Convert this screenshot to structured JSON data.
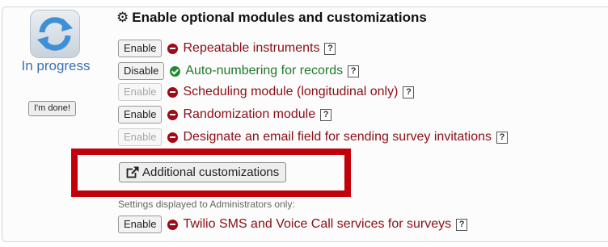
{
  "status": {
    "label": "In progress",
    "done_button": "I'm done!",
    "icon": "sync-arrows-icon"
  },
  "section": {
    "title": "Enable optional modules and customizations",
    "icon": "gears-icon"
  },
  "modules": [
    {
      "button": "Enable",
      "button_enabled": true,
      "status": "red",
      "label": "Repeatable instruments",
      "help": "?"
    },
    {
      "button": "Disable",
      "button_enabled": true,
      "status": "green",
      "label": "Auto-numbering for records",
      "help": "?"
    },
    {
      "button": "Enable",
      "button_enabled": false,
      "status": "red",
      "label": "Scheduling module (longitudinal only)",
      "help": "?"
    },
    {
      "button": "Enable",
      "button_enabled": true,
      "status": "red",
      "label": "Randomization module",
      "help": "?"
    },
    {
      "button": "Enable",
      "button_enabled": false,
      "status": "red",
      "label": "Designate an email field for sending survey invitations",
      "help": "?"
    }
  ],
  "customizations_button": "Additional customizations",
  "admin_note": "Settings displayed to Administrators only:",
  "admin_modules": [
    {
      "button": "Enable",
      "button_enabled": true,
      "status": "red",
      "label": "Twilio SMS and Voice Call services for surveys",
      "help": "?"
    }
  ],
  "colors": {
    "enabled_red": "#8b0e15",
    "enabled_green": "#1f7a2a",
    "highlight": "#c2000b",
    "status_blue": "#3a72b0"
  }
}
